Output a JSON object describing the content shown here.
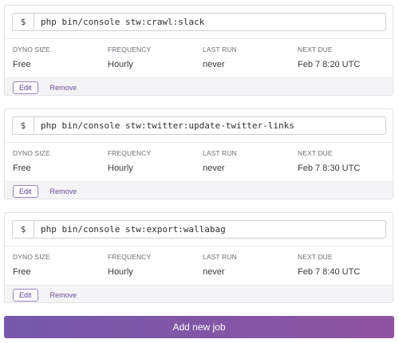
{
  "prompt_symbol": "$",
  "labels": {
    "dyno_size": "DYNO SIZE",
    "frequency": "FREQUENCY",
    "last_run": "LAST RUN",
    "next_due": "NEXT DUE"
  },
  "actions": {
    "edit": "Edit",
    "remove": "Remove"
  },
  "jobs": [
    {
      "command": "php bin/console stw:crawl:slack",
      "dyno_size": "Free",
      "frequency": "Hourly",
      "last_run": "never",
      "next_due": "Feb 7 8:20 UTC"
    },
    {
      "command": "php bin/console stw:twitter:update-twitter-links",
      "dyno_size": "Free",
      "frequency": "Hourly",
      "last_run": "never",
      "next_due": "Feb 7 8:30 UTC"
    },
    {
      "command": "php bin/console stw:export:wallabag",
      "dyno_size": "Free",
      "frequency": "Hourly",
      "last_run": "never",
      "next_due": "Feb 7 8:40 UTC"
    }
  ],
  "add_button": "Add new job",
  "colors": {
    "accent": "#8b57a3",
    "gradient_start": "#7459aa",
    "gradient_end": "#8e54a1",
    "link": "#6a4d98"
  }
}
